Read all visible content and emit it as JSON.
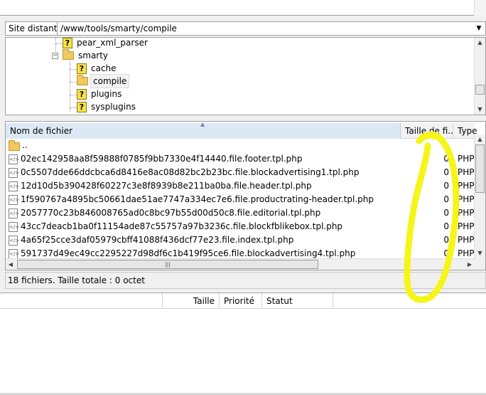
{
  "remote": {
    "label": "Site distant :",
    "path": "/www/tools/smarty/compile"
  },
  "tree": {
    "items": [
      {
        "label": "pear_xml_parser",
        "icon": "unknown-folder-icon"
      },
      {
        "label": "smarty",
        "icon": "folder-icon",
        "expander": "−"
      },
      {
        "label": "cache",
        "icon": "unknown-folder-icon"
      },
      {
        "label": "compile",
        "icon": "folder-icon",
        "selected": true
      },
      {
        "label": "plugins",
        "icon": "unknown-folder-icon"
      },
      {
        "label": "sysplugins",
        "icon": "unknown-folder-icon"
      }
    ]
  },
  "list": {
    "headers": {
      "name": "Nom de fichier",
      "size": "Taille de fi...",
      "type": "Type"
    },
    "parent": "..",
    "files": [
      {
        "name": "02ec142958aa8f59888f0785f9bb7330e4f14440.file.footer.tpl.php",
        "size": "0",
        "type": "PHP"
      },
      {
        "name": "0c5507dde66ddcbca6d8416e8ac08d82bc2b23bc.file.blockadvertising1.tpl.php",
        "size": "0",
        "type": "PHP"
      },
      {
        "name": "12d10d5b390428f60227c3e8f8939b8e211ba0ba.file.header.tpl.php",
        "size": "0",
        "type": "PHP"
      },
      {
        "name": "1f590767a4895bc50661dae51ae7747a334ec7e6.file.productrating-header.tpl.php",
        "size": "0",
        "type": "PHP"
      },
      {
        "name": "2057770c23b846008765ad0c8bc97b55d00d50c8.file.editorial.tpl.php",
        "size": "0",
        "type": "PHP"
      },
      {
        "name": "43cc7deacb1ba0f11154ade87c55757a97b3236c.file.blockfblikebox.tpl.php",
        "size": "0",
        "type": "PHP"
      },
      {
        "name": "4a65f25cce3daf05979cbff41088f436dcf77e23.file.index.tpl.php",
        "size": "0",
        "type": "PHP"
      },
      {
        "name": "591737d49ec49cc2295227d98df6c1b419f95ce6.file.blockadvertising4.tpl.php",
        "size": "0",
        "type": "PHP"
      }
    ],
    "status": "18 fichiers. Taille totale : 0 octet"
  },
  "queue": {
    "headers": {
      "size": "Taille",
      "priority": "Priorité",
      "status": "Statut"
    }
  },
  "colors": {
    "annotation": "#f5f51a",
    "header_selected": "#dce9f5"
  }
}
